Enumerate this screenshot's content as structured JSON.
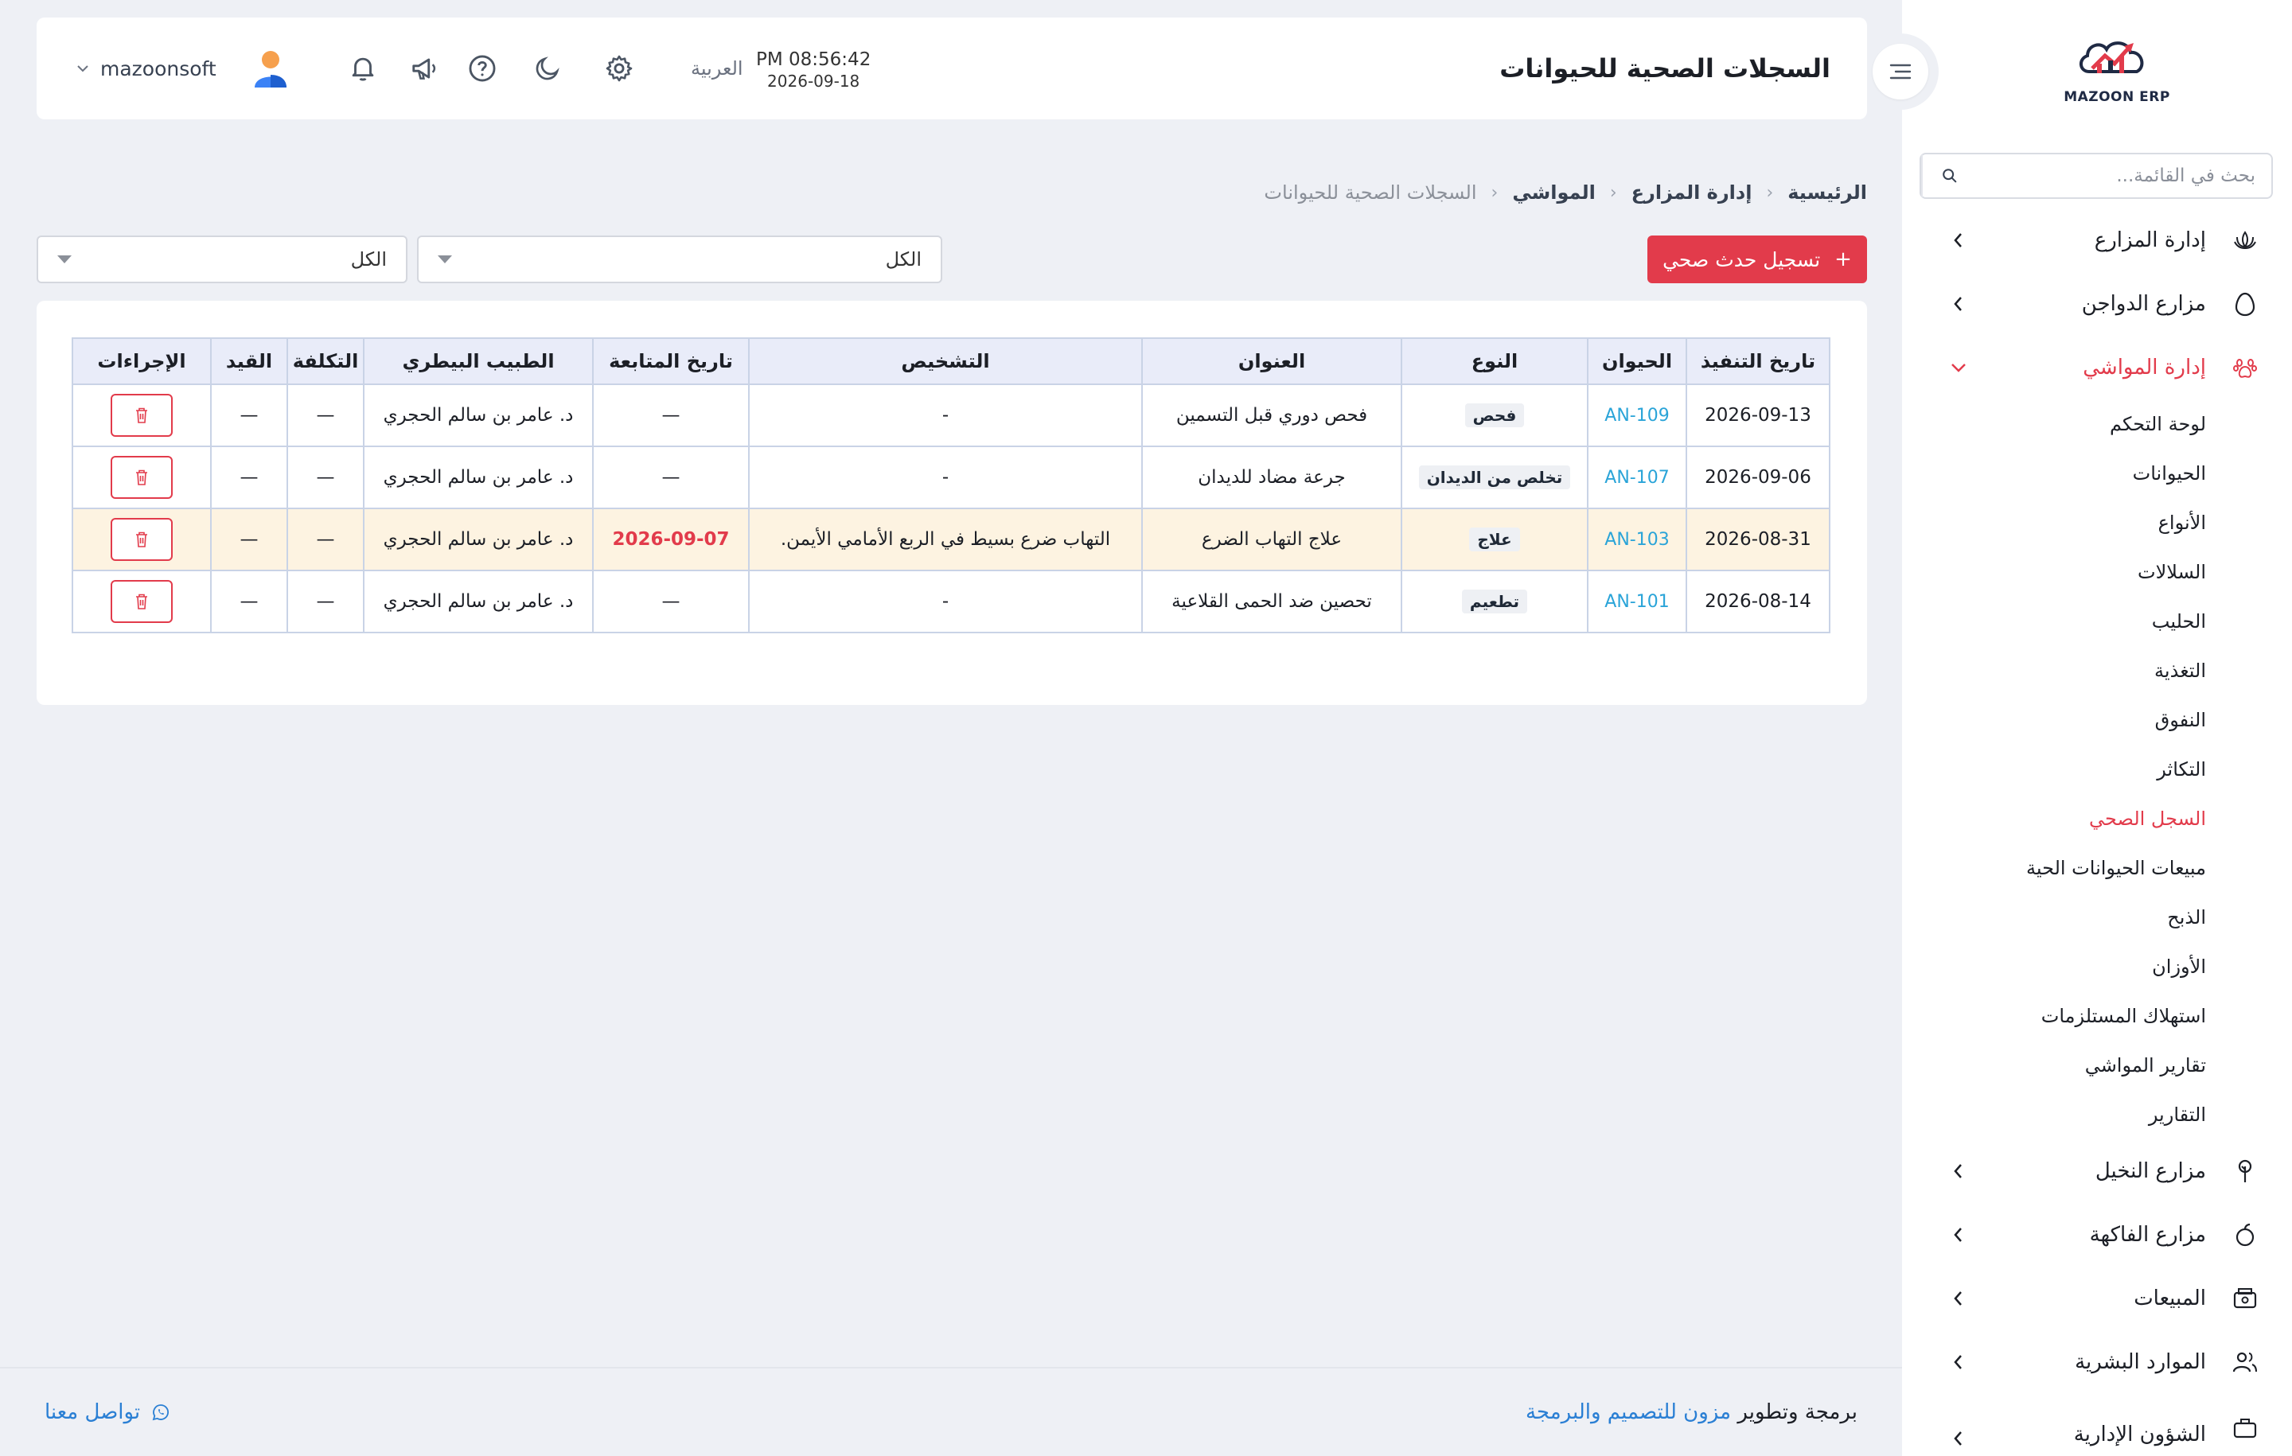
{
  "app": {
    "logo_text": "MAZOON ERP",
    "page_title": "السجلات الصحية للحيوانات"
  },
  "sidebar": {
    "search_placeholder": "بحث في القائمة...",
    "groups_top": [
      {
        "label": "إدارة المزارع",
        "icon": "lotus-icon"
      },
      {
        "label": "مزارع الدواجن",
        "icon": "egg-icon"
      },
      {
        "label": "إدارة المواشي",
        "icon": "paw-icon",
        "active": true
      }
    ],
    "livestock_items": [
      {
        "label": "لوحة التحكم"
      },
      {
        "label": "الحيوانات"
      },
      {
        "label": "الأنواع"
      },
      {
        "label": "السلالات"
      },
      {
        "label": "الحليب"
      },
      {
        "label": "التغذية"
      },
      {
        "label": "النفوق"
      },
      {
        "label": "التكاثر"
      },
      {
        "label": "السجل الصحي",
        "active": true
      },
      {
        "label": "مبيعات الحيوانات الحية"
      },
      {
        "label": "الذبح"
      },
      {
        "label": "الأوزان"
      },
      {
        "label": "استهلاك المستلزمات"
      },
      {
        "label": "تقارير المواشي"
      },
      {
        "label": "التقارير"
      }
    ],
    "groups_bottom": [
      {
        "label": "مزارع النخيل",
        "icon": "palm-icon"
      },
      {
        "label": "مزارع الفاكهة",
        "icon": "fruit-icon"
      },
      {
        "label": "المبيعات",
        "icon": "register-icon"
      },
      {
        "label": "الموارد البشرية",
        "icon": "users-icon"
      },
      {
        "label": "الشؤون الإدارية",
        "icon": "briefcase-icon"
      }
    ]
  },
  "header": {
    "clock_time": "PM 08:56:42",
    "clock_date": "2026-09-18",
    "language": "العربية",
    "username": "mazoonsoft"
  },
  "breadcrumb": [
    "الرئيسية",
    "إدارة المزارع",
    "المواشي",
    "السجلات الصحية للحيوانات"
  ],
  "toolbar": {
    "add_label": "تسجيل حدث صحي",
    "filter_1_value": "الكل",
    "filter_2_value": "الكل"
  },
  "table": {
    "headers": [
      "تاريخ التنفيذ",
      "الحيوان",
      "النوع",
      "العنوان",
      "التشخيص",
      "تاريخ المتابعة",
      "الطبيب البيطري",
      "التكلفة",
      "القيد",
      "الإجراءات"
    ],
    "rows": [
      {
        "date": "2026-09-13",
        "animal": "AN-109",
        "type": "فحص",
        "title": "فحص دوري قبل التسمين",
        "diagnosis": "-",
        "followup": "—",
        "vet": "د. عامر بن سالم الحجري",
        "cost": "—",
        "entry": "—"
      },
      {
        "date": "2026-09-06",
        "animal": "AN-107",
        "type": "تخلص من الديدان",
        "title": "جرعة مضاد للديدان",
        "diagnosis": "-",
        "followup": "—",
        "vet": "د. عامر بن سالم الحجري",
        "cost": "—",
        "entry": "—"
      },
      {
        "date": "2026-08-31",
        "animal": "AN-103",
        "type": "علاج",
        "title": "علاج التهاب الضرع",
        "diagnosis": "التهاب ضرع بسيط في الربع الأمامي الأيمن.",
        "followup": "2026-09-07",
        "vet": "د. عامر بن سالم الحجري",
        "cost": "—",
        "entry": "—",
        "highlight": true
      },
      {
        "date": "2026-08-14",
        "animal": "AN-101",
        "type": "تطعيم",
        "title": "تحصين ضد الحمى القلاعية",
        "diagnosis": "-",
        "followup": "—",
        "vet": "د. عامر بن سالم الحجري",
        "cost": "—",
        "entry": "—"
      }
    ]
  },
  "footer": {
    "credit_prefix": "برمجة وتطوير",
    "credit_company": "مزون للتصميم والبرمجة",
    "contact_label": "تواصل معنا"
  },
  "colors": {
    "accent": "#e23b4b",
    "link": "#2aa4d8",
    "highlight_row": "#fdf3e1",
    "table_header": "#e9ecf9"
  }
}
